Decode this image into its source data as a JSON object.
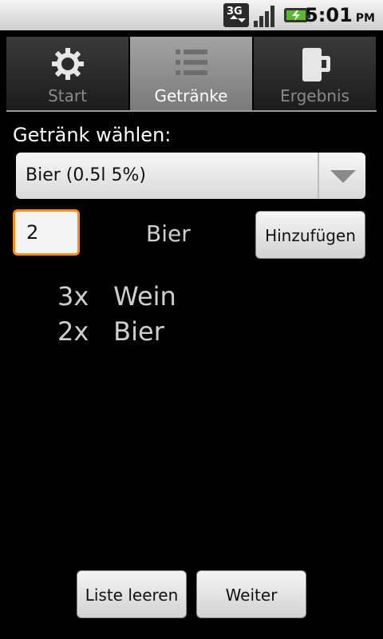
{
  "status_bar": {
    "time": "5:01",
    "ampm": "PM",
    "network": "3G"
  },
  "tabs": [
    {
      "label": "Start",
      "icon": "gear-icon"
    },
    {
      "label": "Getränke",
      "icon": "list-icon",
      "selected": true
    },
    {
      "label": "Ergebnis",
      "icon": "mug-icon"
    }
  ],
  "form": {
    "drink_prompt": "Getränk wählen:",
    "drink_selected": "Bier (0.5l 5%)",
    "quantity": "2",
    "drink_name": "Bier",
    "add_label": "Hinzufügen"
  },
  "drink_list": [
    {
      "count": "3x",
      "name": "Wein"
    },
    {
      "count": "2x",
      "name": "Bier"
    }
  ],
  "actions": {
    "clear_label": "Liste leeren",
    "next_label": "Weiter"
  },
  "colors": {
    "focus_border": "#ff8c1a",
    "tab_selected": "#8f8f8f"
  }
}
